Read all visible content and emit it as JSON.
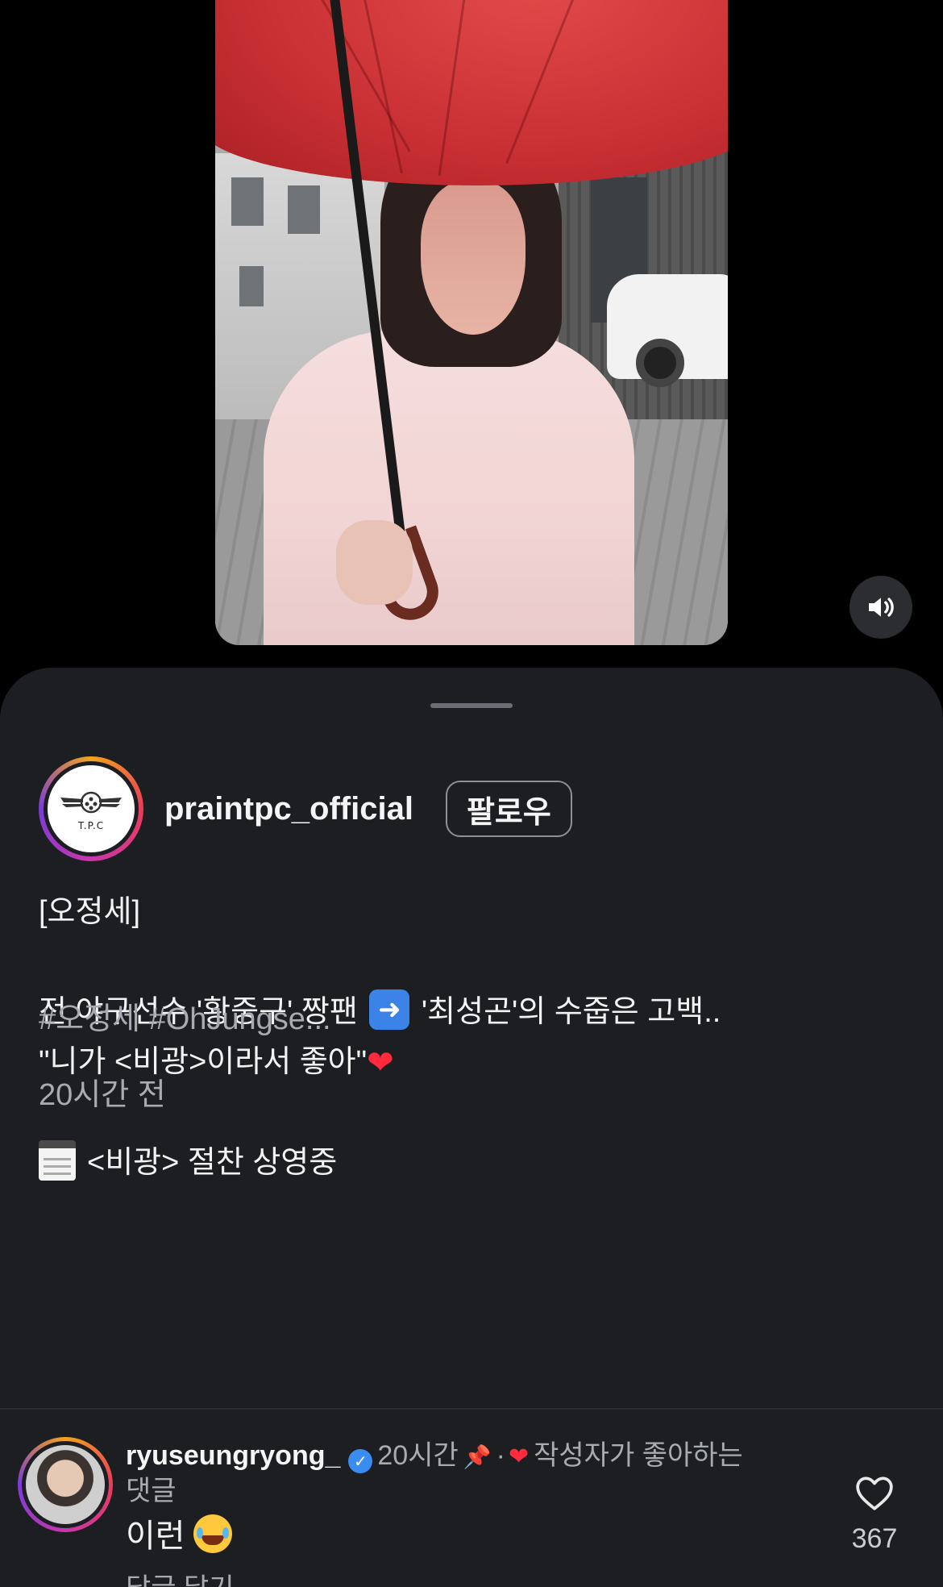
{
  "video": {
    "volume_icon": "speaker-volume-icon"
  },
  "post": {
    "account": {
      "username": "praintpc_official",
      "avatar_logo_text": "T.P.C",
      "follow_label": "팔로우"
    },
    "caption": {
      "line1": "[오정세]",
      "line2_before": "전 야구선수 '황중구' 짱팬",
      "line2_after": "'최성곤'의 수줍은 고백..",
      "line3": "\"니가 <비광>이라서 좋아\"",
      "line4": "<비광> 절찬 상영중"
    },
    "hashtags": "#오정세 #OhJungse...",
    "time_ago": "20시간 전"
  },
  "comment": {
    "username": "ryuseungryong_",
    "time": "20시간",
    "separator": "·",
    "creator_liked_label": "작성자가 좋아하는",
    "creator_liked_suffix": "댓글",
    "text": "이런",
    "reply_label": "답글 달기",
    "like_count": "367"
  },
  "colors": {
    "background": "#000000",
    "sheet": "#1c1e22",
    "muted_text": "#a8abb1",
    "verified": "#3b8cf0",
    "heart": "#ff2a3c"
  }
}
